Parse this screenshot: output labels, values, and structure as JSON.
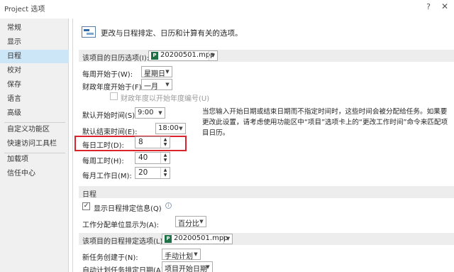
{
  "window": {
    "title": "Project 选项",
    "help": "?",
    "close": "✕"
  },
  "sidebar": {
    "items": [
      "常规",
      "显示",
      "日程",
      "校对",
      "保存",
      "语言",
      "高级",
      "自定义功能区",
      "快速访问工具栏",
      "加载项",
      "信任中心"
    ],
    "active": "日程"
  },
  "header": {
    "text": "更改与日程排定、日历和计算有关的选项。",
    "icon": "calendar-options-icon"
  },
  "calendar_section": {
    "label": "该项目的日历选项(I):",
    "project": "20200501.mpp",
    "week_start_label": "每周开始于(W):",
    "week_start_value": "星期日",
    "fiscal_start_label": "财政年度开始于(F):",
    "fiscal_start_value": "一月",
    "fiscal_numbering_label": "财政年度以开始年度编号(U)",
    "default_start_label": "默认开始时间(S):",
    "default_start_value": "9:00",
    "default_end_label": "默认结束时间(E):",
    "default_end_value": "18:00",
    "hours_per_day_label": "每日工时(D):",
    "hours_per_day_value": "8",
    "hours_per_week_label": "每周工时(H):",
    "hours_per_week_value": "40",
    "days_per_month_label": "每月工作日(M):",
    "days_per_month_value": "20",
    "hint": "当您输入开始日期或结束日期而不指定时间时，这些时间会被分配给任务。如果要更改此设置，请考虑使用功能区中“项目”选项卡上的“更改工作时间”命令来匹配项目日历。"
  },
  "schedule_section": {
    "label": "日程",
    "show_schedule_msgs_label": "显示日程排定信息(Q)",
    "show_schedule_msgs_checked": "✓",
    "units_label": "工作分配单位显示为(A):",
    "units_value": "百分比"
  },
  "schedule_options_section": {
    "label": "该项目的日程排定选项(L):",
    "project": "20200501.mpp",
    "new_tasks_label": "新任务创建于(N):",
    "new_tasks_value": "手动计划",
    "auto_sched_label": "自动计划任务排定日期(A):",
    "auto_sched_value": "项目开始日期"
  },
  "glyphs": {
    "arrow": "▼",
    "up": "▲",
    "down": "▼",
    "info": "i"
  }
}
